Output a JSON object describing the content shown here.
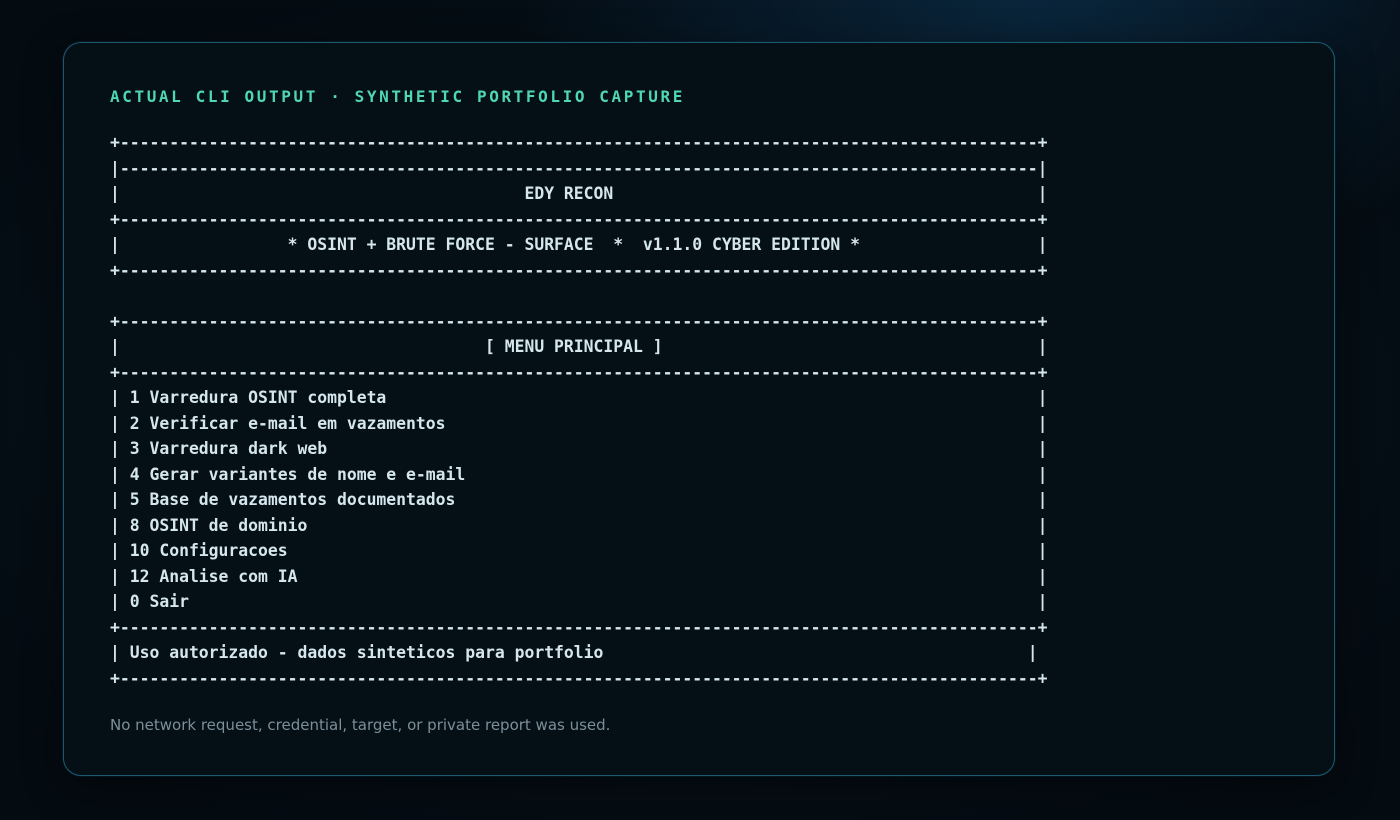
{
  "panel": {
    "heading": "ACTUAL CLI OUTPUT · SYNTHETIC PORTFOLIO CAPTURE",
    "footer_note": "No network request, credential, target, or private report was used."
  },
  "terminal": {
    "border_top": "+---------------------------------------------------------------------------------------------+",
    "border_double": "|---------------------------------------------------------------------------------------------|",
    "app_title_line": "|                                         EDY RECON                                           |",
    "separator_1": "+---------------------------------------------------------------------------------------------+",
    "tagline_line": "|                 * OSINT + BRUTE FORCE - SURFACE  *  v1.1.0 CYBER EDITION *                  |",
    "separator_2": "+---------------------------------------------------------------------------------------------+",
    "blank_line": "",
    "menu_border_top": "+---------------------------------------------------------------------------------------------+",
    "menu_title_line": "|                                     [ MENU PRINCIPAL ]                                      |",
    "menu_separator": "+---------------------------------------------------------------------------------------------+",
    "menu_items": [
      "| 1 Varredura OSINT completa                                                                  |",
      "| 2 Verificar e-mail em vazamentos                                                            |",
      "| 3 Varredura dark web                                                                        |",
      "| 4 Gerar variantes de nome e e-mail                                                          |",
      "| 5 Base de vazamentos documentados                                                           |",
      "| 8 OSINT de dominio                                                                          |",
      "| 10 Configuracoes                                                                            |",
      "| 12 Analise com IA                                                                           |",
      "| 0 Sair                                                                                      |"
    ],
    "menu_footer_separator": "+---------------------------------------------------------------------------------------------+",
    "notice_line": "| Uso autorizado - dados sinteticos para portfolio                                           |",
    "border_bottom": "+---------------------------------------------------------------------------------------------+"
  }
}
